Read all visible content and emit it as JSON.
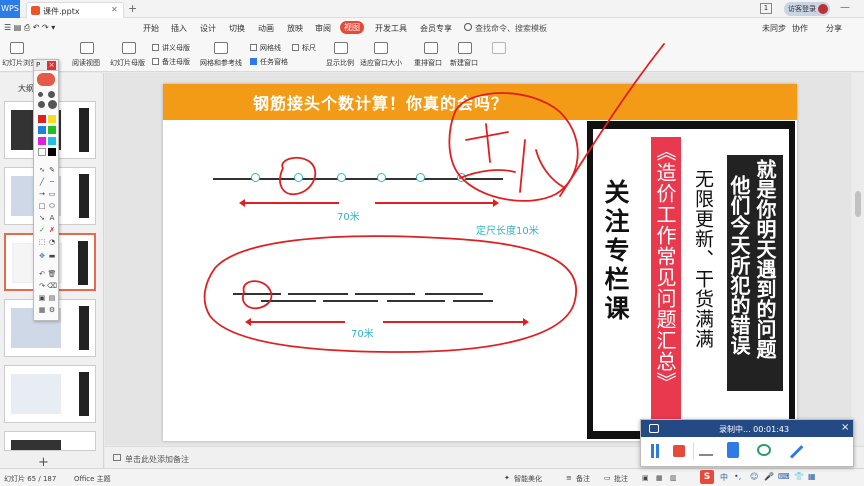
{
  "titlebar": {
    "app_corner": "WPS",
    "file_tab": "课件.pptx",
    "page_badge": "1",
    "login": "访客登录"
  },
  "menu": {
    "items": [
      "开始",
      "插入",
      "设计",
      "切换",
      "动画",
      "放映",
      "审阅",
      "视图",
      "开发工具",
      "会员专享"
    ],
    "active": "视图",
    "search": "查找命令、搜索模板",
    "right": [
      "未同步",
      "协作",
      "分享"
    ]
  },
  "ribbon": {
    "labels": [
      "幻灯片浏览",
      "阅读视图",
      "幻灯片母版",
      "讲义母版",
      "备注母版",
      "网格和参考线",
      "网格线",
      "标尺",
      "任务窗格",
      "显示比例",
      "适应窗口大小",
      "重排窗口",
      "新建窗口"
    ],
    "task_pane_checked": true
  },
  "leftpanel": {
    "outline_tab": "大纲",
    "add_button": "+"
  },
  "pentool": {
    "title": "P",
    "close": "×",
    "colors": [
      "#e02020",
      "#f0e020",
      "#2080e0",
      "#20c020",
      "#e020e0",
      "#20c0e0",
      "#ffffff",
      "#000000"
    ]
  },
  "slide": {
    "title": "钢筋接头个数计算！你真的会吗？",
    "label_70m_top": "70米",
    "label_70m_bottom": "70米",
    "label_length": "定尺长度10米",
    "col_focus": "关注专栏课",
    "col_series": "《造价工作常见问题汇总》",
    "col_update": "无限更新、干货满满",
    "col_mistakes_1": "就是你明天遇到的问题",
    "col_mistakes_2": "他们今天所犯的错误"
  },
  "notes": {
    "placeholder": "单击此处添加备注"
  },
  "status": {
    "slide_counter": "幻灯片 65 / 187",
    "theme": "Office 主题",
    "beautify": "智能美化",
    "notes": "备注",
    "comments": "批注"
  },
  "recorder": {
    "status": "录制中... 00:01:43",
    "close": "×"
  },
  "ime": {
    "logo": "S",
    "mode": "中"
  },
  "colors": {
    "accent": "#e84a3a",
    "slide_header": "#f39b17",
    "series_bg": "#e8394e",
    "ink": "#e02020",
    "cyan": "#2fb3c9"
  }
}
